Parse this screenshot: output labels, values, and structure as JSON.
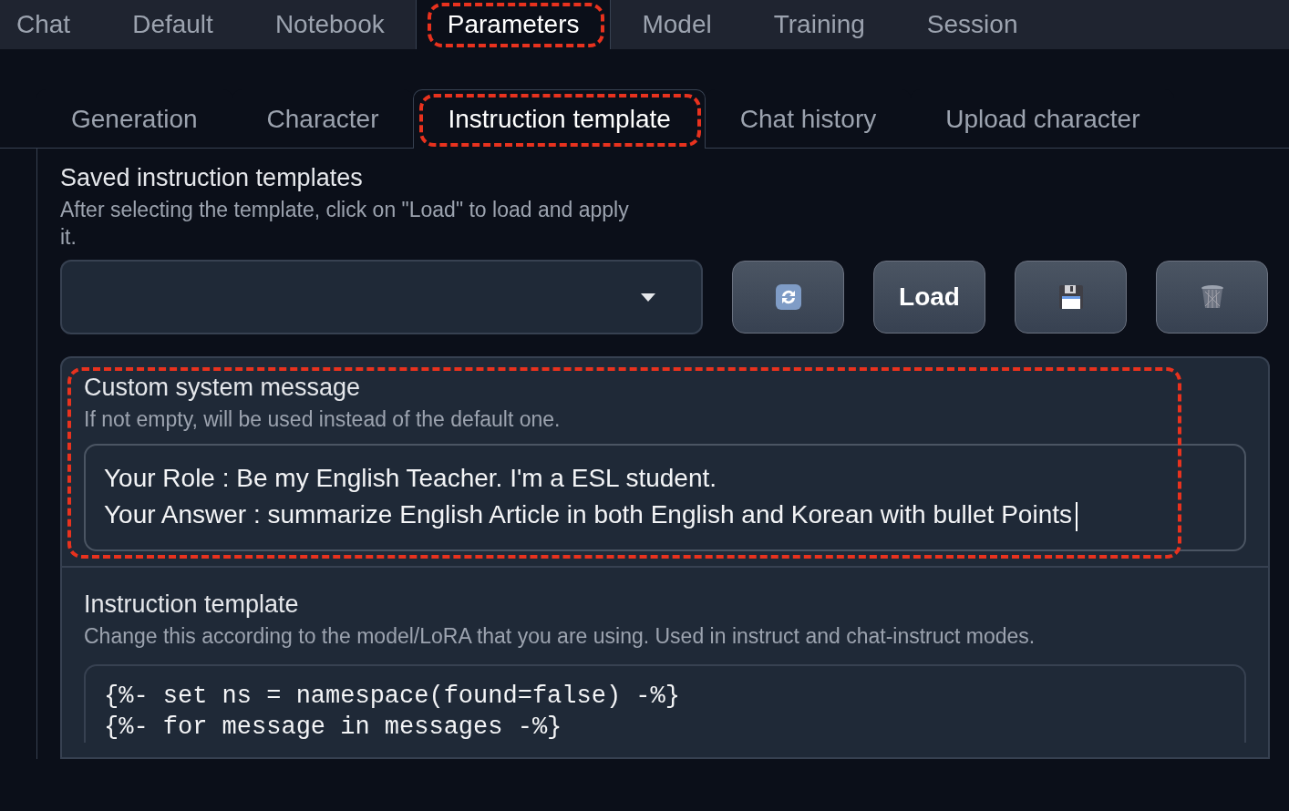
{
  "main_tabs": [
    {
      "label": "Chat",
      "selected": false,
      "annotated": false
    },
    {
      "label": "Default",
      "selected": false,
      "annotated": false
    },
    {
      "label": "Notebook",
      "selected": false,
      "annotated": false
    },
    {
      "label": "Parameters",
      "selected": true,
      "annotated": true
    },
    {
      "label": "Model",
      "selected": false,
      "annotated": false
    },
    {
      "label": "Training",
      "selected": false,
      "annotated": false
    },
    {
      "label": "Session",
      "selected": false,
      "annotated": false
    }
  ],
  "sub_tabs": [
    {
      "label": "Generation",
      "selected": false,
      "annotated": false
    },
    {
      "label": "Character",
      "selected": false,
      "annotated": false
    },
    {
      "label": "Instruction template",
      "selected": true,
      "annotated": true
    },
    {
      "label": "Chat history",
      "selected": false,
      "annotated": false
    },
    {
      "label": "Upload character",
      "selected": false,
      "annotated": false
    }
  ],
  "saved_templates": {
    "title": "Saved instruction templates",
    "description": "After selecting the template, click on \"Load\" to load and apply it.",
    "buttons": [
      {
        "kind": "refresh"
      },
      {
        "kind": "text",
        "label": "Load"
      },
      {
        "kind": "save"
      },
      {
        "kind": "delete"
      }
    ]
  },
  "custom_system_message": {
    "title": "Custom system message",
    "description": "If not empty, will be used instead of the default one.",
    "annotated": true,
    "focused": true,
    "value": [
      "Your Role : Be my English Teacher. I'm a ESL student.",
      "Your Answer : summarize English Article in both English and Korean with bullet Points"
    ]
  },
  "instruction_template": {
    "title": "Instruction template",
    "description": "Change this according to the model/LoRA that you are using. Used in instruct and chat-instruct modes.",
    "code": [
      "{%- set ns = namespace(found=false) -%}",
      "{%- for message in messages -%}"
    ]
  }
}
